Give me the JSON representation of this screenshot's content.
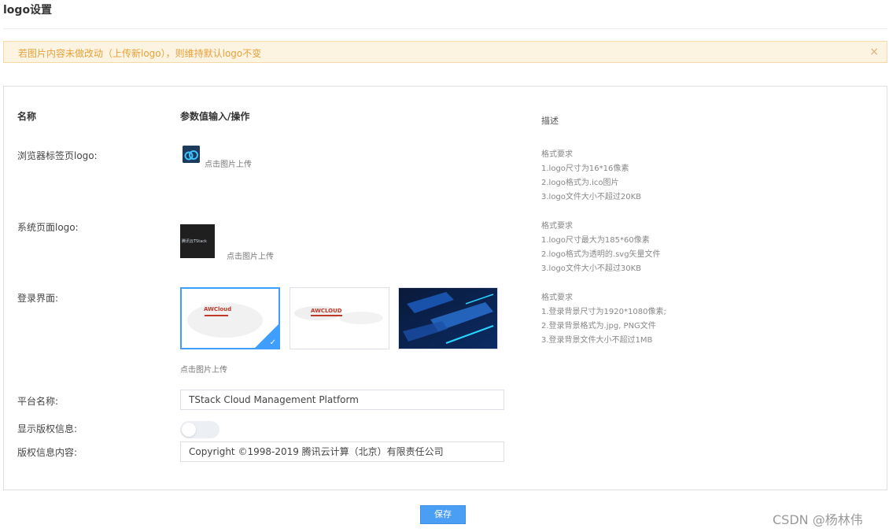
{
  "page": {
    "title": "logo设置"
  },
  "alert": {
    "text": "若图片内容未做改动（上传新logo），则维持默认logo不变",
    "close": "×"
  },
  "table": {
    "col_name": "名称",
    "col_input": "参数值输入/操作",
    "col_desc": "描述"
  },
  "rows": {
    "favicon": {
      "label": "浏览器标签页logo:",
      "upload_hint": "点击图片上传",
      "desc": [
        "格式要求",
        "1.logo尺寸为16*16像素",
        "2.logo格式为.ico图片",
        "3.logo文件大小不超过20KB"
      ]
    },
    "system_logo": {
      "label": "系统页面logo:",
      "logo_text": "腾讯云TStack",
      "upload_hint": "点击图片上传",
      "desc": [
        "格式要求",
        "1.logo尺寸最大为185*60像素",
        "2.logo格式为透明的.svg矢量文件",
        "3.logo文件大小不超过30KB"
      ]
    },
    "login": {
      "label": "登录界面:",
      "thumb1_brand": "AWCloud",
      "thumb2_brand": "AWCLOUD",
      "selected_check": "✓",
      "upload_hint": "点击图片上传",
      "desc": [
        "格式要求",
        "1.登录背景尺寸为1920*1080像素;",
        "2.登录背景格式为.jpg, PNG文件",
        "3.登录背景文件大小不超过1MB"
      ]
    },
    "platform_name": {
      "label": "平台名称:",
      "value": "TStack Cloud Management Platform"
    },
    "show_copyright": {
      "label": "显示版权信息:",
      "enabled": false
    },
    "copyright": {
      "label": "版权信息内容:",
      "value": "Copyright ©1998-2019 腾讯云计算（北京）有限责任公司"
    }
  },
  "actions": {
    "save_label": "保存"
  },
  "watermark": "CSDN @杨林伟",
  "colors": {
    "accent": "#409eff",
    "warning_bg": "#fdf3e1",
    "warning_text": "#e6a23c"
  }
}
